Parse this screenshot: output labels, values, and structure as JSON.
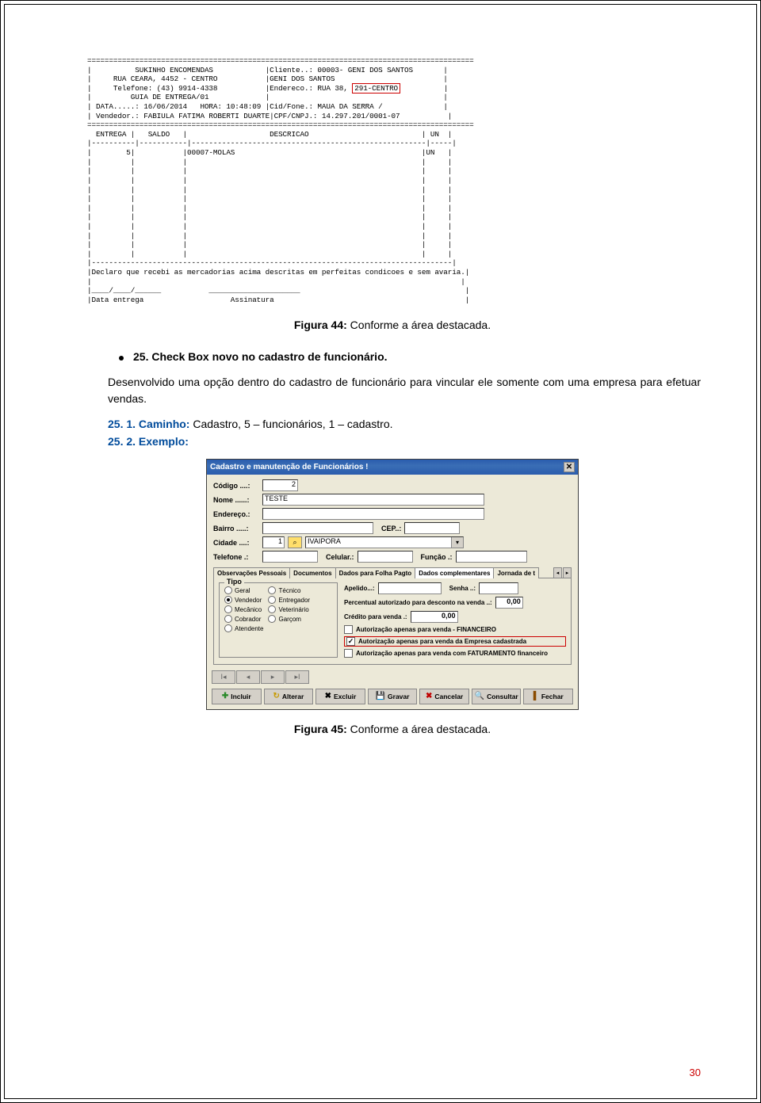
{
  "figure44": {
    "caption_prefix": "Figura 44:",
    "caption_text": " Conforme a área destacada."
  },
  "receipt": {
    "sep_top": "=========================================================================================",
    "header_left": [
      "          SUKINHO ENCOMENDAS            ",
      "     RUA CEARA, 4452 - CENTRO           ",
      "     Telefone: (43) 9914-4338           ",
      "         GUIA DE ENTREGA/01             "
    ],
    "header_right": [
      "Cliente..: 00003- GENI DOS SANTOS",
      "GENI DOS SANTOS",
      "Endereco.: RUA 38, "
    ],
    "endereco_highlight": "291-CENTRO",
    "data_line_left": " DATA.....: 16/06/2014   HORA: 10:48:09 ",
    "data_line_right": "Cid/Fone.: MAUA DA SERRA /",
    "vendedor_left": " Vendedor.: FABIULA FATIMA ROBERTI DUARTE",
    "vendedor_right": "CPF/CNPJ.: 14.297.201/0001-07",
    "sep_eq": "=========================================================================================",
    "table_header": "  ENTREGA |   SALDO   |                   DESCRICAO                          | UN  |",
    "sep_dash": "|----------|-----------|------------------------------------------------------|-----|",
    "row1": "|        5|           |00007-MOLAS                                           |UN   |",
    "blank_row": "|         |           |                                                      |     |",
    "sep_dash2": "|-----------------------------------------------------------------------------------|",
    "declare": "|Declaro que recebi as mercadorias acima descritas em perfeitas condicoes e sem avaria.|",
    "blank_line": "|                                                                                     |",
    "date_line": "|____/____/______           _____________________                                      |",
    "footer": "|Data entrega                    Assinatura                                            |"
  },
  "section": {
    "bullet": "25. Check Box novo no cadastro de funcionário.",
    "para": "Desenvolvido uma opção dentro do cadastro de funcionário para vincular ele somente com uma empresa para efetuar vendas.",
    "line1_prefix": "25. 1. Caminho:",
    "line1_text": " Cadastro, 5 – funcionários, 1 – cadastro.",
    "line2_prefix": "25. 2. Exemplo:"
  },
  "dialog": {
    "title": "Cadastro e manutenção de Funcionários !",
    "labels": {
      "codigo": "Código ....:",
      "nome": "Nome ......:",
      "endereco": "Endereço.:",
      "bairro": "Bairro .....:",
      "cep": "CEP..:",
      "cidade": "Cidade ....:",
      "telefone": "Telefone .:",
      "celular": "Celular.:",
      "funcao": "Função .:"
    },
    "values": {
      "codigo": "2",
      "nome": "TESTE",
      "cidade_num": "1",
      "cidade_nome": "IVAIPORA"
    },
    "tabs": {
      "t1": "Observações Pessoais",
      "t2": "Documentos",
      "t3": "Dados para Folha Pagto",
      "t4": "Dados complementares",
      "t5": "Jornada de t"
    },
    "tipo": {
      "legend": "Tipo",
      "geral": "Geral",
      "vendedor": "Vendedor",
      "mecanico": "Mecânico",
      "cobrador": "Cobrador",
      "atendente": "Atendente",
      "tecnico": "Técnico",
      "entregador": "Entregador",
      "veterinario": "Veterinário",
      "garcom": "Garçom"
    },
    "right": {
      "apelido": "Apelido...:",
      "senha": "Senha   ..:",
      "percent": "Percentual autorizado para desconto na venda ..:",
      "percent_val": "0,00",
      "credito": "Crédito para venda .:",
      "credito_val": "0,00",
      "c1": "Autorização apenas para venda - FINANCEIRO",
      "c2": "Autorização apenas para venda da Empresa cadastrada",
      "c3": "Autorização apenas para venda com FATURAMENTO financeiro"
    },
    "buttons": {
      "incluir": "Incluir",
      "alterar": "Alterar",
      "excluir": "Excluir",
      "gravar": "Gravar",
      "cancelar": "Cancelar",
      "consultar": "Consultar",
      "fechar": "Fechar"
    }
  },
  "figure45": {
    "caption_prefix": "Figura 45:",
    "caption_text": " Conforme a área destacada."
  },
  "page_number": "30"
}
